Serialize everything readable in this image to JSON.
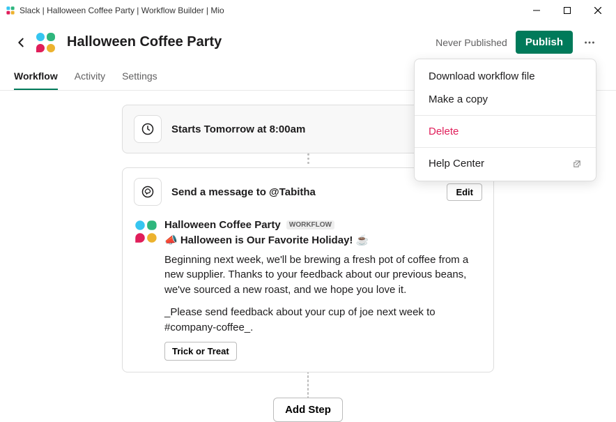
{
  "window": {
    "title": "Slack | Halloween Coffee Party | Workflow Builder | Mio"
  },
  "header": {
    "title": "Halloween Coffee Party",
    "status": "Never Published",
    "publish_label": "Publish"
  },
  "tabs": {
    "workflow": "Workflow",
    "activity": "Activity",
    "settings": "Settings"
  },
  "trigger": {
    "text": "Starts Tomorrow at 8:00am"
  },
  "step": {
    "head": "Send a message to @Tabitha",
    "edit": "Edit",
    "app_name": "Halloween Coffee Party",
    "badge": "WORKFLOW",
    "title_line": "📣 Halloween is Our Favorite Holiday! ☕",
    "body": "Beginning next week, we'll be brewing a fresh pot of coffee from a new supplier. Thanks to your feedback about our previous beans, we've sourced a new roast, and we hope you love it.",
    "feedback": "_Please send feedback about your cup of joe next week to #company-coffee_.",
    "button": "Trick or Treat"
  },
  "add_step": "Add Step",
  "menu": {
    "download": "Download workflow file",
    "copy": "Make a copy",
    "delete": "Delete",
    "help": "Help Center"
  }
}
